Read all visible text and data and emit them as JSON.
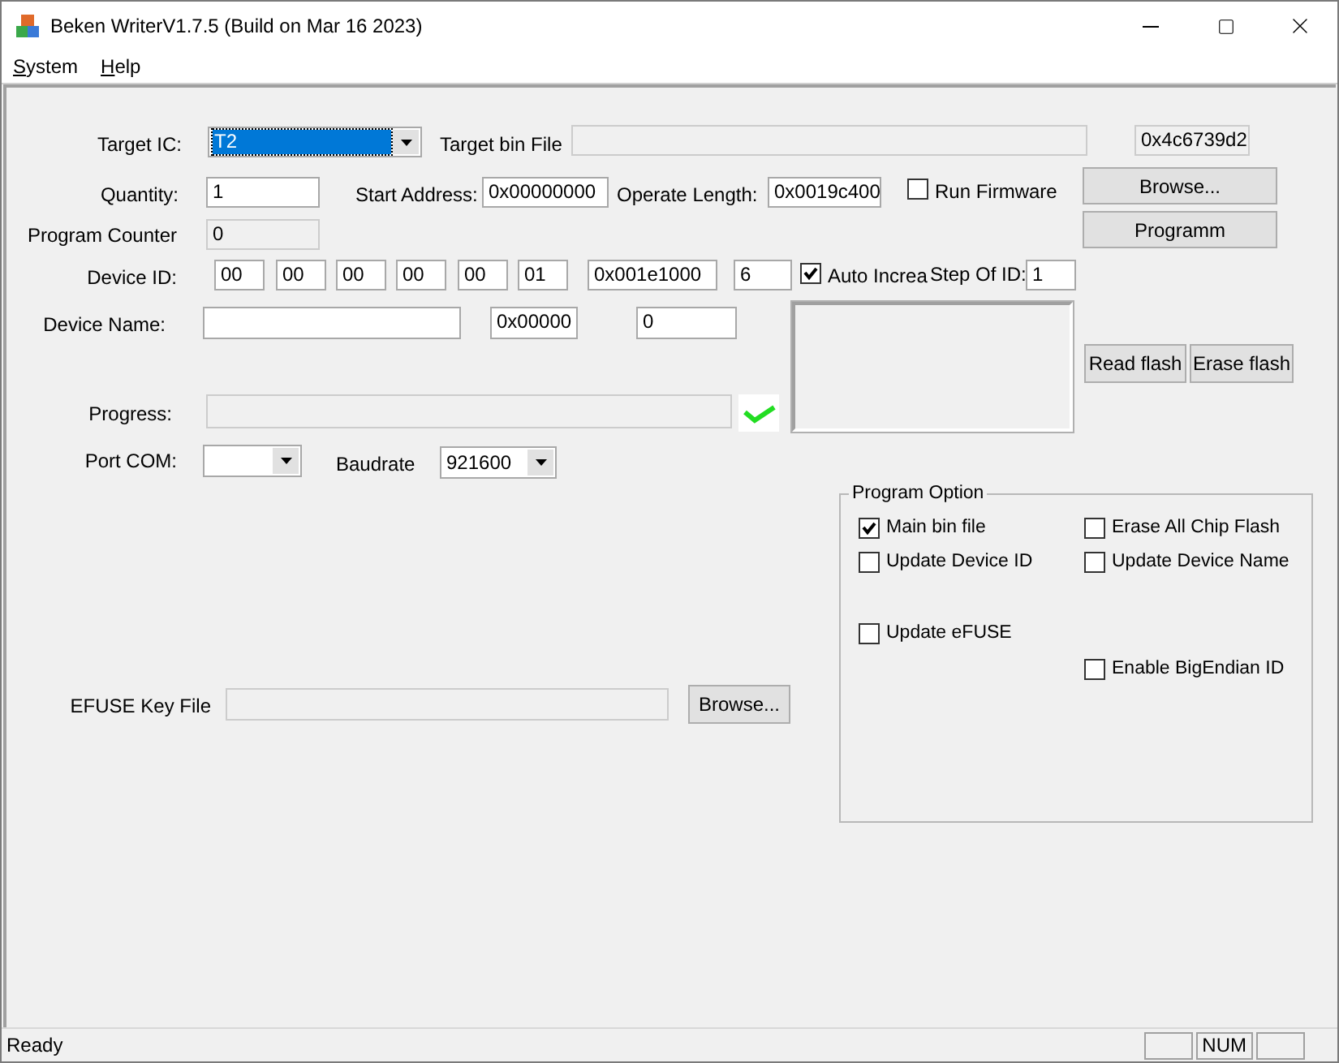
{
  "window": {
    "title": "Beken WriterV1.7.5 (Build on Mar 16 2023)"
  },
  "menu": [
    {
      "accel": "S",
      "rest": "ystem"
    },
    {
      "accel": "H",
      "rest": "elp"
    }
  ],
  "form": {
    "target_ic": {
      "label": "Target IC:",
      "value": "T2",
      "focused": true
    },
    "target_bin_file": {
      "label": "Target bin File",
      "disabled": true
    },
    "checksum": {
      "value": "0x4c6739d2",
      "disabled": true
    },
    "quantity": {
      "label": "Quantity:",
      "value": "1",
      "disabled": false
    },
    "start_address": {
      "label": "Start Address:",
      "value": "0x00000000",
      "disabled": false
    },
    "operate_length": {
      "label": "Operate Length:",
      "value": "0x0019c400",
      "disabled": false
    },
    "run_firmware": {
      "label": "Run Firmware",
      "checked": false
    },
    "browse_button": "Browse...",
    "program_button": "Programm",
    "program_counter": {
      "label": "Program Counter",
      "value": "0",
      "disabled": true
    },
    "device_id": {
      "label": "Device ID:",
      "bytes": [
        "00",
        "00",
        "00",
        "00",
        "00",
        "01"
      ],
      "hex": "0x001e1000",
      "length": "6"
    },
    "auto_increase": {
      "label": "Auto Increa",
      "checked": true
    },
    "step_of_id": {
      "label": "Step Of ID:",
      "value": "1"
    },
    "device_name": {
      "label": "Device Name:",
      "hex": "0x00000",
      "count": "0"
    },
    "read_flash_button": "Read flash",
    "erase_flash_button": "Erase flash",
    "progress": {
      "label": "Progress:",
      "level": 0
    },
    "port_com": {
      "label": "Port COM:"
    },
    "baudrate": {
      "label": "Baudrate",
      "value": "921600"
    },
    "efuse_key_file": {
      "label": "EFUSE Key File",
      "disabled": true
    },
    "efuse_browse_button": "Browse..."
  },
  "program_option": {
    "title": "Program Option",
    "options": [
      {
        "label": "Main bin file",
        "checked": true
      },
      {
        "label": "Erase All Chip Flash",
        "checked": false
      },
      {
        "label": "Update Device ID",
        "checked": false
      },
      {
        "label": "Update Device Name",
        "checked": false
      },
      {
        "label": "Update eFUSE",
        "checked": false
      },
      {
        "label": "Enable BigEndian ID",
        "checked": false
      }
    ]
  },
  "status_bar": {
    "message": "Ready",
    "panes": [
      {
        "kind": "blank"
      },
      {
        "kind": "text",
        "text": "NUM"
      },
      {
        "kind": "blank"
      }
    ]
  }
}
